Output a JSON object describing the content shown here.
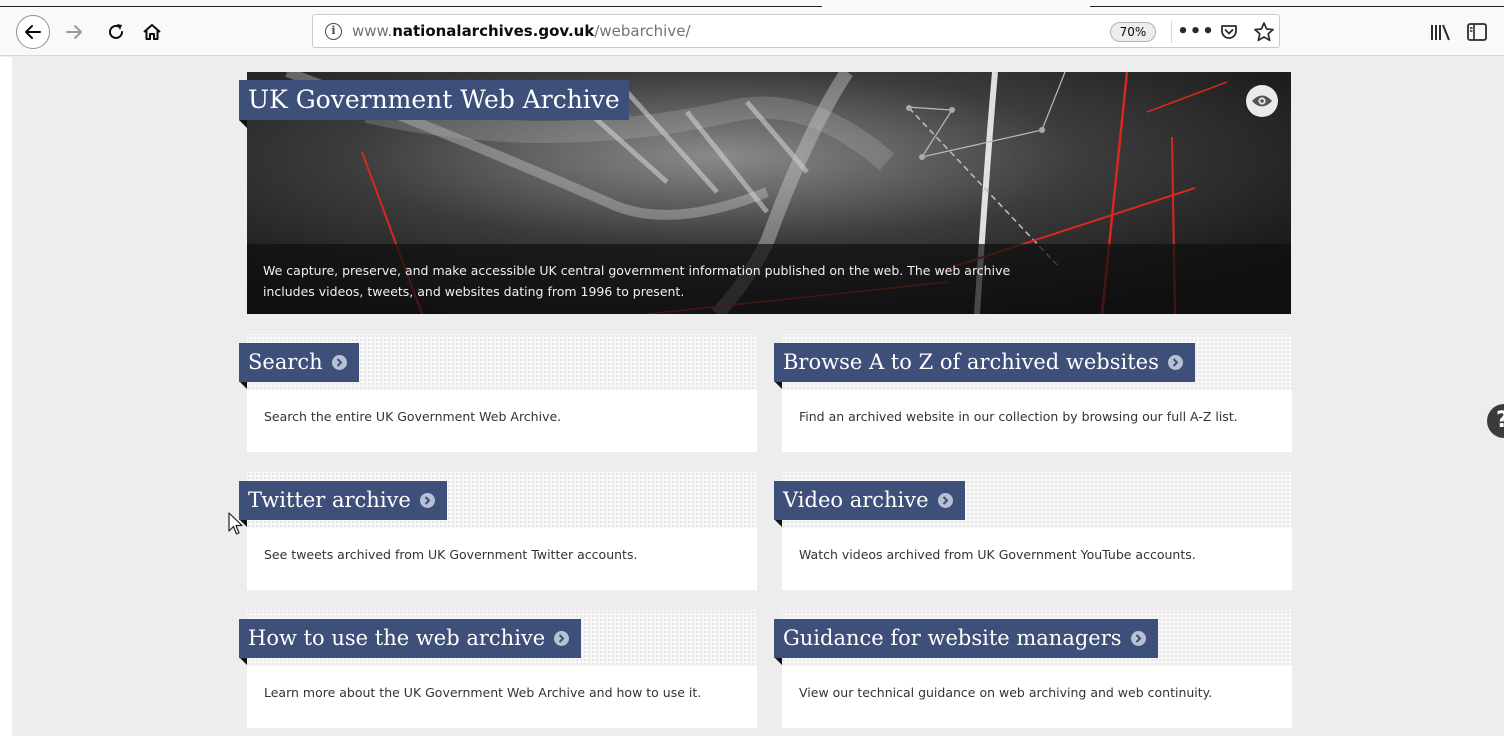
{
  "browser": {
    "url_prefix": "www.",
    "url_domain": "nationalarchives.gov.uk",
    "url_path": "/webarchive/",
    "zoom": "70%",
    "icons": [
      "back-arrow",
      "forward-arrow",
      "reload",
      "home",
      "site-info",
      "page-actions-more",
      "pocket",
      "bookmark-star",
      "library",
      "sidebar"
    ]
  },
  "hero": {
    "title": "UK Government Web Archive",
    "caption": "We capture, preserve, and make accessible UK central government information published on the web. The web archive includes videos, tweets, and websites dating from 1996 to present.",
    "icon": "eye"
  },
  "cards": [
    {
      "title": "Search",
      "description": "Search the entire UK Government Web Archive."
    },
    {
      "title": "Browse A to Z of archived websites",
      "description": "Find an archived website in our collection by browsing our full A-Z list."
    },
    {
      "title": "Twitter archive",
      "description": "See tweets archived from UK Government Twitter accounts."
    },
    {
      "title": "Video archive",
      "description": "Watch videos archived from UK Government YouTube accounts."
    },
    {
      "title": "How to use the web archive",
      "description": "Learn more about the UK Government Web Archive and how to use it."
    },
    {
      "title": "Guidance for website managers",
      "description": "View our technical guidance on web archiving and web continuity."
    }
  ],
  "help_button": {
    "label": "?"
  },
  "colors": {
    "banner": "#3e5079",
    "page_bg": "#ededed",
    "hero_accent": "#d6281e"
  }
}
